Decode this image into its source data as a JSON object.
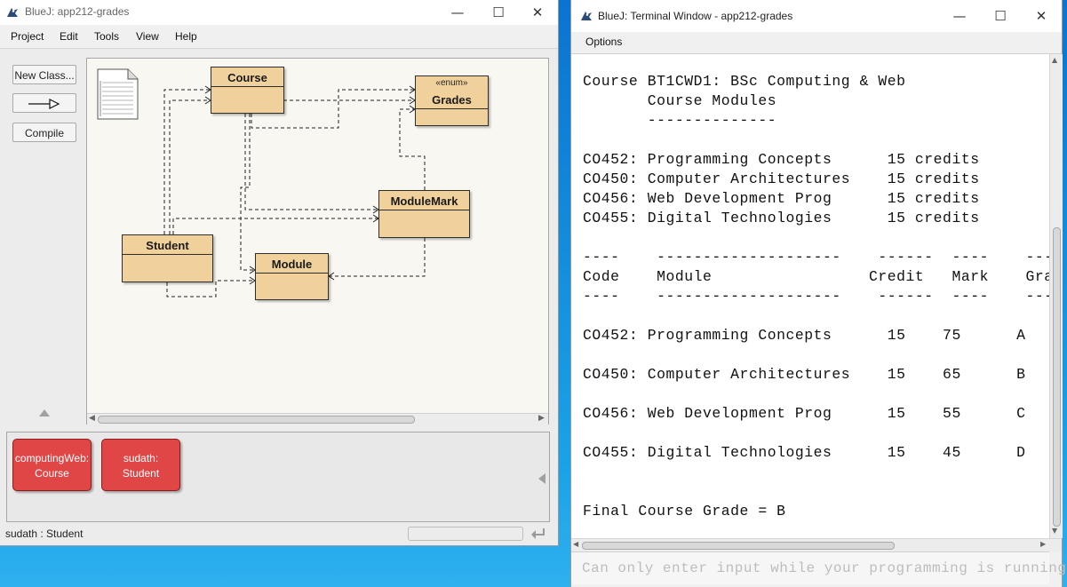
{
  "main_window": {
    "title": "BlueJ:  app212-grades",
    "controls": {
      "minimize": "—",
      "maximize": "☐",
      "close": "✕"
    },
    "menu": [
      "Project",
      "Edit",
      "Tools",
      "View",
      "Help"
    ],
    "side_buttons": {
      "new_class": "New Class...",
      "arrow": "⟶▷",
      "compile": "Compile"
    },
    "diagram": {
      "classes": {
        "course": {
          "name": "Course"
        },
        "grades": {
          "name": "Grades",
          "stereotype": "«enum»"
        },
        "modulemark": {
          "name": "ModuleMark"
        },
        "student": {
          "name": "Student"
        },
        "module": {
          "name": "Module"
        }
      }
    },
    "object_bench": [
      {
        "line1": "computingWeb:",
        "line2": "Course"
      },
      {
        "line1": "sudath:",
        "line2": "Student"
      }
    ],
    "status": "sudath : Student"
  },
  "terminal": {
    "title": "BlueJ: Terminal Window - app212-grades",
    "controls": {
      "minimize": "—",
      "maximize": "☐",
      "close": "✕"
    },
    "menu": [
      "Options"
    ],
    "lines": [
      "Course BT1CWD1: BSc Computing & Web",
      "       Course Modules",
      "       --------------",
      "",
      "CO452: Programming Concepts      15 credits",
      "CO450: Computer Architectures    15 credits",
      "CO456: Web Development Prog      15 credits",
      "CO455: Digital Technologies      15 credits",
      "",
      "----    --------------------    ------  ----    -----",
      "Code    Module                 Credit   Mark    Grade",
      "----    --------------------    ------  ----    -----",
      "",
      "CO452: Programming Concepts      15    75      A",
      "",
      "CO450: Computer Architectures    15    65      B",
      "",
      "CO456: Web Development Prog      15    55      C",
      "",
      "CO455: Digital Technologies      15    45      D",
      "",
      "",
      "Final Course Grade = B"
    ],
    "input_placeholder": "Can only enter input while your programming is running"
  }
}
